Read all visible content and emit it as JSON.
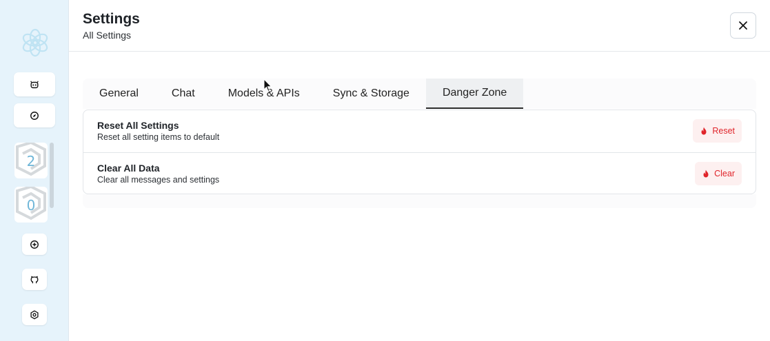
{
  "header": {
    "title": "Settings",
    "subtitle": "All Settings"
  },
  "sidebar": {
    "avatars": [
      {
        "badge": "2"
      },
      {
        "badge": "0"
      }
    ],
    "icons": [
      "logo-icon",
      "bot-icon",
      "compass-icon",
      "plus-circle-icon",
      "github-icon",
      "settings-icon"
    ]
  },
  "tabs": [
    {
      "label": "General",
      "active": false
    },
    {
      "label": "Chat",
      "active": false
    },
    {
      "label": "Models & APIs",
      "active": false
    },
    {
      "label": "Sync & Storage",
      "active": false
    },
    {
      "label": "Danger Zone",
      "active": true
    }
  ],
  "danger_zone": {
    "items": [
      {
        "title": "Reset All Settings",
        "description": "Reset all setting items to default",
        "button": "Reset"
      },
      {
        "title": "Clear All Data",
        "description": "Clear all messages and settings",
        "button": "Clear"
      }
    ]
  },
  "colors": {
    "sidebar_bg": "#e6f3fb",
    "danger": "#e0242a",
    "danger_bg": "#fdf0f0"
  }
}
